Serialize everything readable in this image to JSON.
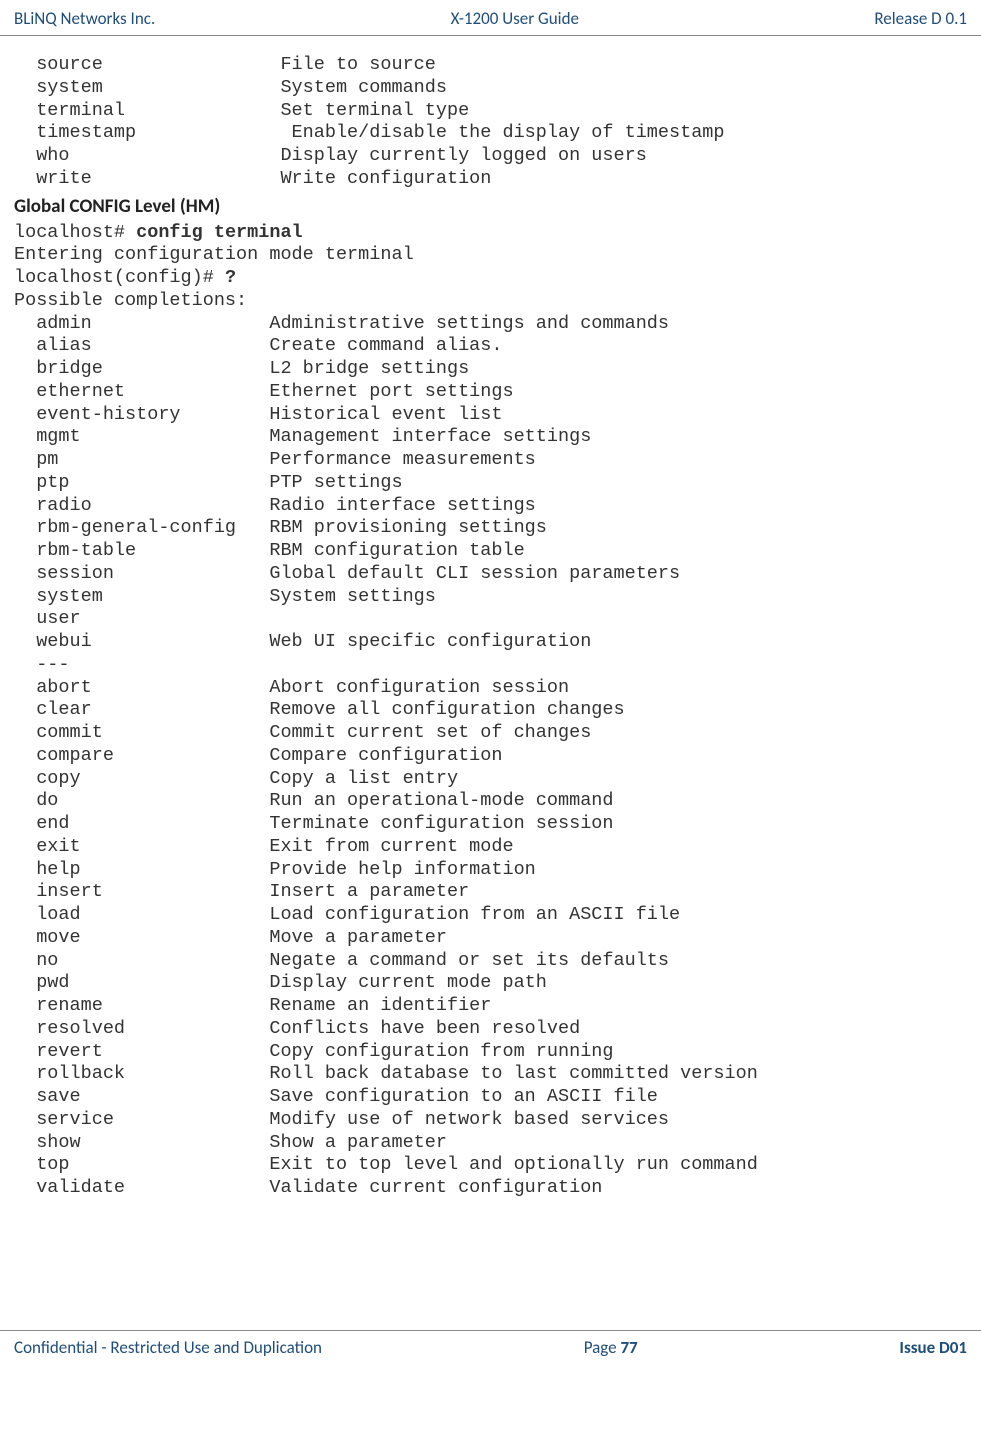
{
  "header": {
    "left": "BLiNQ Networks Inc.",
    "center": "X-1200 User Guide",
    "right": "Release D 0.1"
  },
  "top_block": [
    {
      "cmd": "source",
      "desc": "File to source"
    },
    {
      "cmd": "system",
      "desc": "System commands"
    },
    {
      "cmd": "terminal",
      "desc": "Set terminal type"
    },
    {
      "cmd": "timestamp",
      "desc": "Enable/disable the display of timestamp"
    },
    {
      "cmd": "who",
      "desc": "Display currently logged on users"
    },
    {
      "cmd": "write",
      "desc": "Write configuration"
    }
  ],
  "section_heading": "Global CONFIG Level (HM)",
  "prompt1_prefix": "localhost# ",
  "prompt1_cmd": "config terminal",
  "line_entering": "Entering configuration mode terminal",
  "prompt2_prefix": "localhost(config)# ",
  "prompt2_cmd": "?",
  "possible_completions": "Possible completions:",
  "config_block": [
    {
      "cmd": "admin",
      "desc": "Administrative settings and commands"
    },
    {
      "cmd": "alias",
      "desc": "Create command alias."
    },
    {
      "cmd": "bridge",
      "desc": "L2 bridge settings"
    },
    {
      "cmd": "ethernet",
      "desc": "Ethernet port settings"
    },
    {
      "cmd": "event-history",
      "desc": "Historical event list"
    },
    {
      "cmd": "mgmt",
      "desc": "Management interface settings"
    },
    {
      "cmd": "pm",
      "desc": "Performance measurements"
    },
    {
      "cmd": "ptp",
      "desc": "PTP settings"
    },
    {
      "cmd": "radio",
      "desc": "Radio interface settings"
    },
    {
      "cmd": "rbm-general-config",
      "desc": "RBM provisioning settings"
    },
    {
      "cmd": "rbm-table",
      "desc": "RBM configuration table"
    },
    {
      "cmd": "session",
      "desc": "Global default CLI session parameters"
    },
    {
      "cmd": "system",
      "desc": "System settings"
    },
    {
      "cmd": "user",
      "desc": ""
    },
    {
      "cmd": "webui",
      "desc": "Web UI specific configuration"
    },
    {
      "cmd": "---",
      "desc": ""
    },
    {
      "cmd": "abort",
      "desc": "Abort configuration session"
    },
    {
      "cmd": "clear",
      "desc": "Remove all configuration changes"
    },
    {
      "cmd": "commit",
      "desc": "Commit current set of changes"
    },
    {
      "cmd": "compare",
      "desc": "Compare configuration"
    },
    {
      "cmd": "copy",
      "desc": "Copy a list entry"
    },
    {
      "cmd": "do",
      "desc": "Run an operational-mode command"
    },
    {
      "cmd": "end",
      "desc": "Terminate configuration session"
    },
    {
      "cmd": "exit",
      "desc": "Exit from current mode"
    },
    {
      "cmd": "help",
      "desc": "Provide help information"
    },
    {
      "cmd": "insert",
      "desc": "Insert a parameter"
    },
    {
      "cmd": "load",
      "desc": "Load configuration from an ASCII file"
    },
    {
      "cmd": "move",
      "desc": "Move a parameter"
    },
    {
      "cmd": "no",
      "desc": "Negate a command or set its defaults"
    },
    {
      "cmd": "pwd",
      "desc": "Display current mode path"
    },
    {
      "cmd": "rename",
      "desc": "Rename an identifier"
    },
    {
      "cmd": "resolved",
      "desc": "Conflicts have been resolved"
    },
    {
      "cmd": "revert",
      "desc": "Copy configuration from running"
    },
    {
      "cmd": "rollback",
      "desc": "Roll back database to last committed version"
    },
    {
      "cmd": "save",
      "desc": "Save configuration to an ASCII file"
    },
    {
      "cmd": "service",
      "desc": "Modify use of network based services"
    },
    {
      "cmd": "show",
      "desc": "Show a parameter"
    },
    {
      "cmd": "top",
      "desc": "Exit to top level and optionally run command"
    },
    {
      "cmd": "validate",
      "desc": "Validate current configuration"
    }
  ],
  "footer": {
    "left": "Confidential - Restricted Use and Duplication",
    "page_label": "Page ",
    "page_number": "77",
    "right": "Issue D01"
  }
}
